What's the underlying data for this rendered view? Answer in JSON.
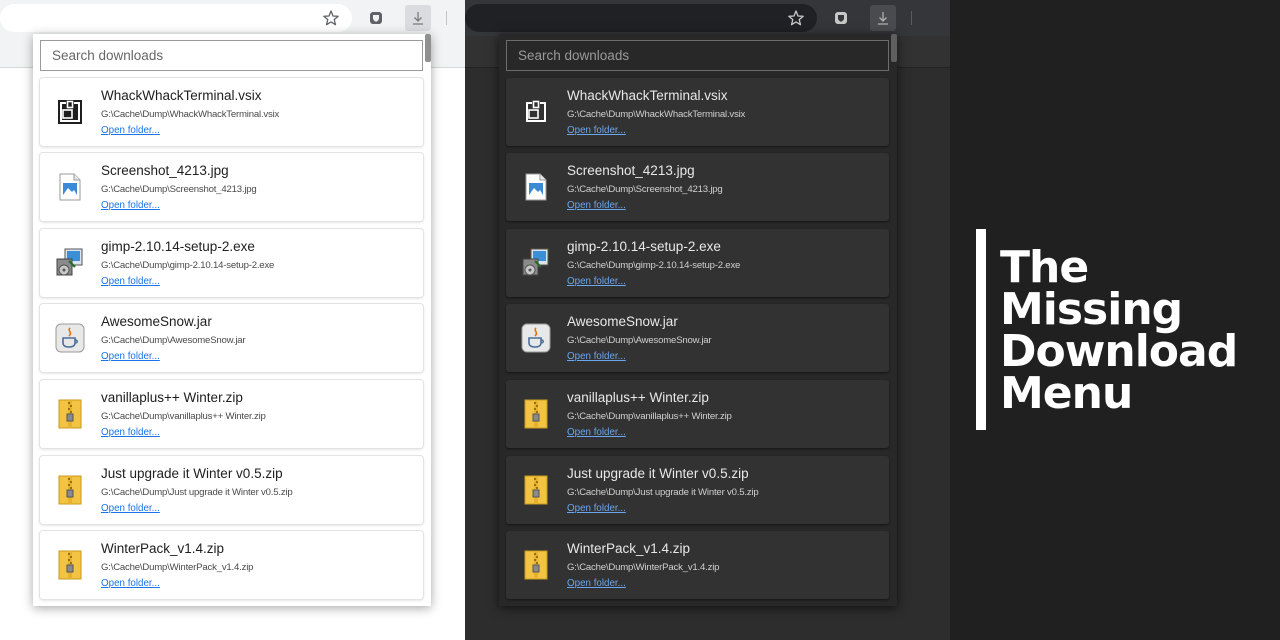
{
  "toolbar": {
    "bookmark_icon": "star-icon",
    "extension_icon": "shield-extension-icon",
    "downloads_icon": "download-arrow-icon"
  },
  "search": {
    "placeholder": "Search downloads"
  },
  "downloads": [
    {
      "name": "WhackWhackTerminal.vsix",
      "path": "G:\\Cache\\Dump\\WhackWhackTerminal.vsix",
      "action": "Open folder...",
      "icon": "vsix-package-icon"
    },
    {
      "name": "Screenshot_4213.jpg",
      "path": "G:\\Cache\\Dump\\Screenshot_4213.jpg",
      "action": "Open folder...",
      "icon": "image-file-icon"
    },
    {
      "name": "gimp-2.10.14-setup-2.exe",
      "path": "G:\\Cache\\Dump\\gimp-2.10.14-setup-2.exe",
      "action": "Open folder...",
      "icon": "installer-exe-icon"
    },
    {
      "name": "AwesomeSnow.jar",
      "path": "G:\\Cache\\Dump\\AwesomeSnow.jar",
      "action": "Open folder...",
      "icon": "java-jar-icon"
    },
    {
      "name": "vanillaplus++ Winter.zip",
      "path": "G:\\Cache\\Dump\\vanillaplus++ Winter.zip",
      "action": "Open folder...",
      "icon": "zip-archive-icon"
    },
    {
      "name": "Just upgrade it Winter v0.5.zip",
      "path": "G:\\Cache\\Dump\\Just upgrade it Winter v0.5.zip",
      "action": "Open folder...",
      "icon": "zip-archive-icon"
    },
    {
      "name": "WinterPack_v1.4.zip",
      "path": "G:\\Cache\\Dump\\WinterPack_v1.4.zip",
      "action": "Open folder...",
      "icon": "zip-archive-icon"
    }
  ],
  "banner": {
    "title_lines": [
      "The",
      "Missing",
      "Download",
      "Menu"
    ]
  },
  "colors": {
    "link_light": "#1a73e8",
    "link_dark": "#6aa7ee",
    "banner_bg": "#202020",
    "banner_text": "#ffffff"
  }
}
